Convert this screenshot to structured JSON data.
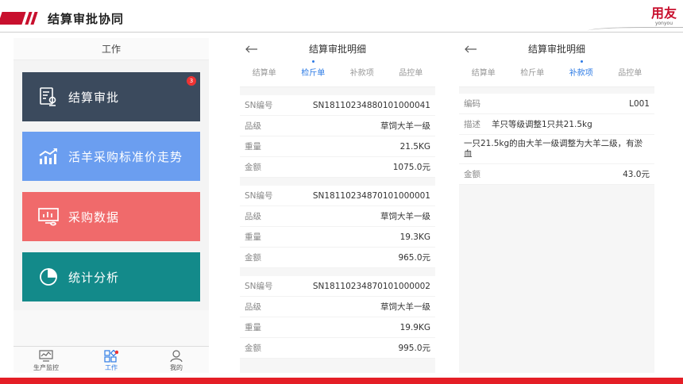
{
  "slide": {
    "title": "结算审批协同",
    "logo_main": "用友",
    "logo_sub": "yonyou"
  },
  "home": {
    "title": "工作",
    "tiles": [
      {
        "label": "结算审批",
        "badge": "3",
        "icon": "approval-doc-icon",
        "color": "#3b4a5d"
      },
      {
        "label": "活羊采购标准价走势",
        "icon": "trend-chart-icon",
        "color": "#6b9ef0"
      },
      {
        "label": "采购数据",
        "icon": "monitor-chart-icon",
        "color": "#f06a6b"
      },
      {
        "label": "统计分析",
        "icon": "pie-chart-icon",
        "color": "#138a8a"
      }
    ],
    "tabbar": [
      {
        "label": "生产监控",
        "icon": "monitor-icon"
      },
      {
        "label": "工作",
        "icon": "grid-apps-icon",
        "active": true
      },
      {
        "label": "我的",
        "icon": "user-icon"
      }
    ]
  },
  "detail_inspection": {
    "title": "结算审批明细",
    "tabs": [
      "结算单",
      "检斤单",
      "补款项",
      "品控单"
    ],
    "active_tab": "检斤单",
    "groups": [
      {
        "sn_label": "SN编号",
        "sn": "SN18110234880101000041",
        "grade_label": "品级",
        "grade": "草饲大羊一级",
        "weight_label": "重量",
        "weight": "21.5KG",
        "amount_label": "金额",
        "amount": "1075.0元"
      },
      {
        "sn_label": "SN编号",
        "sn": "SN18110234870101000001",
        "grade_label": "品级",
        "grade": "草饲大羊一级",
        "weight_label": "重量",
        "weight": "19.3KG",
        "amount_label": "金额",
        "amount": "965.0元"
      },
      {
        "sn_label": "SN编号",
        "sn": "SN18110234870101000002",
        "grade_label": "品级",
        "grade": "草饲大羊一级",
        "weight_label": "重量",
        "weight": "19.9KG",
        "amount_label": "金额",
        "amount": "995.0元"
      }
    ]
  },
  "detail_supplement": {
    "title": "结算审批明细",
    "tabs": [
      "结算单",
      "检斤单",
      "补款项",
      "品控单"
    ],
    "active_tab": "补款项",
    "code_label": "编码",
    "code": "L001",
    "desc_label": "描述",
    "desc": "羊只等级调整1只共21.5kg",
    "note": "一只21.5kg的由大羊一级调整为大羊二级，有淤血",
    "amount_label": "金额",
    "amount": "43.0元"
  },
  "colors": {
    "brand_red": "#c8102e",
    "accent_blue": "#2d7be5",
    "badge_red": "#ee3333"
  }
}
